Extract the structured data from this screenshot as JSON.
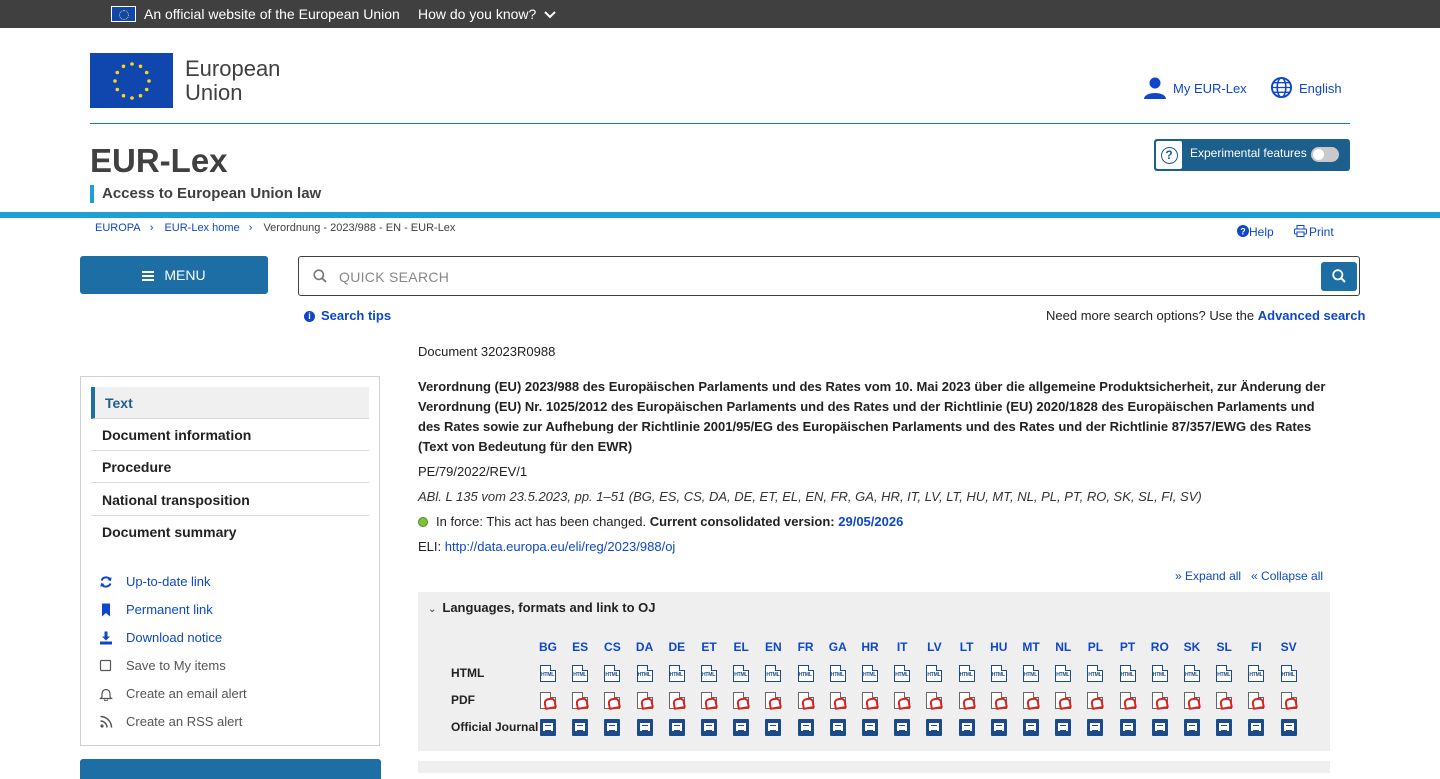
{
  "global_bar": {
    "official_text": "An official website of the European Union",
    "how_text": "How do you know?"
  },
  "header": {
    "org_line1": "European",
    "org_line2": "Union",
    "my_eurlex": "My EUR-Lex",
    "language": "English",
    "site_title": "EUR-Lex",
    "site_subtitle": "Access to European Union law",
    "experimental_label": "Experimental features",
    "experimental_enabled": false
  },
  "breadcrumb": [
    "EUROPA",
    "EUR-Lex home",
    "Verordnung - 2023/988 - EN - EUR-Lex"
  ],
  "utility": {
    "help": "Help",
    "print": "Print"
  },
  "menu_label": "MENU",
  "search": {
    "placeholder": "QUICK SEARCH",
    "tips": "Search tips",
    "more_options": "Need more search options? Use the",
    "advanced": "Advanced search"
  },
  "sidebar": {
    "tabs": [
      "Text",
      "Document information",
      "Procedure",
      "National transposition",
      "Document summary"
    ],
    "active_tab": "Text",
    "links": [
      {
        "label": "Up-to-date link",
        "icon": "refresh-icon"
      },
      {
        "label": "Permanent link",
        "icon": "bookmark-icon"
      },
      {
        "label": "Download notice",
        "icon": "download-icon"
      },
      {
        "label": "Save to My items",
        "icon": "checkbox-icon"
      },
      {
        "label": "Create an email alert",
        "icon": "bell-icon"
      },
      {
        "label": "Create an RSS alert",
        "icon": "rss-icon"
      }
    ]
  },
  "document": {
    "id": "Document 32023R0988",
    "title": "Verordnung (EU) 2023/988 des Europäischen Parlaments und des Rates vom 10. Mai 2023 über die allgemeine Produktsicherheit, zur Änderung der Verordnung (EU) Nr. 1025/2012 des Europäischen Parlaments und des Rates und der Richtlinie (EU) 2020/1828 des Europäischen Parlaments und des Rates sowie zur Aufhebung der Richtlinie 2001/95/EG des Europäischen Parlaments und des Rates und der Richtlinie 87/357/EWG des Rates (Text von Bedeutung für den EWR)",
    "reference": "PE/79/2022/REV/1",
    "oj": "ABl. L 135 vom 23.5.2023, pp. 1–51 (BG, ES, CS, DA, DE, ET, EL, EN, FR, GA, HR, IT, LV, LT, HU, MT, NL, PL, PT, RO, SK, SL, FI, SV)",
    "in_force": "In force: This act has been changed.",
    "consolidated_label": "Current consolidated version:",
    "consolidated_date": "29/05/2026",
    "eli_label": "ELI:",
    "eli_url": "http://data.europa.eu/eli/reg/2023/988/oj",
    "expand_all": "Expand all",
    "collapse_all": "Collapse all"
  },
  "languages_panel": {
    "title": "Languages, formats and link to OJ",
    "rows": [
      "HTML",
      "PDF",
      "Official Journal"
    ],
    "languages": [
      "BG",
      "ES",
      "CS",
      "DA",
      "DE",
      "ET",
      "EL",
      "EN",
      "FR",
      "GA",
      "HR",
      "IT",
      "LV",
      "LT",
      "HU",
      "MT",
      "NL",
      "PL",
      "PT",
      "RO",
      "SK",
      "SL",
      "FI",
      "SV"
    ]
  },
  "colors": {
    "primary": "#1c6ea4",
    "link": "#0e47cb",
    "accent": "#1e9fd6",
    "in_force": "#7cc23d",
    "top_bar": "#404040"
  }
}
